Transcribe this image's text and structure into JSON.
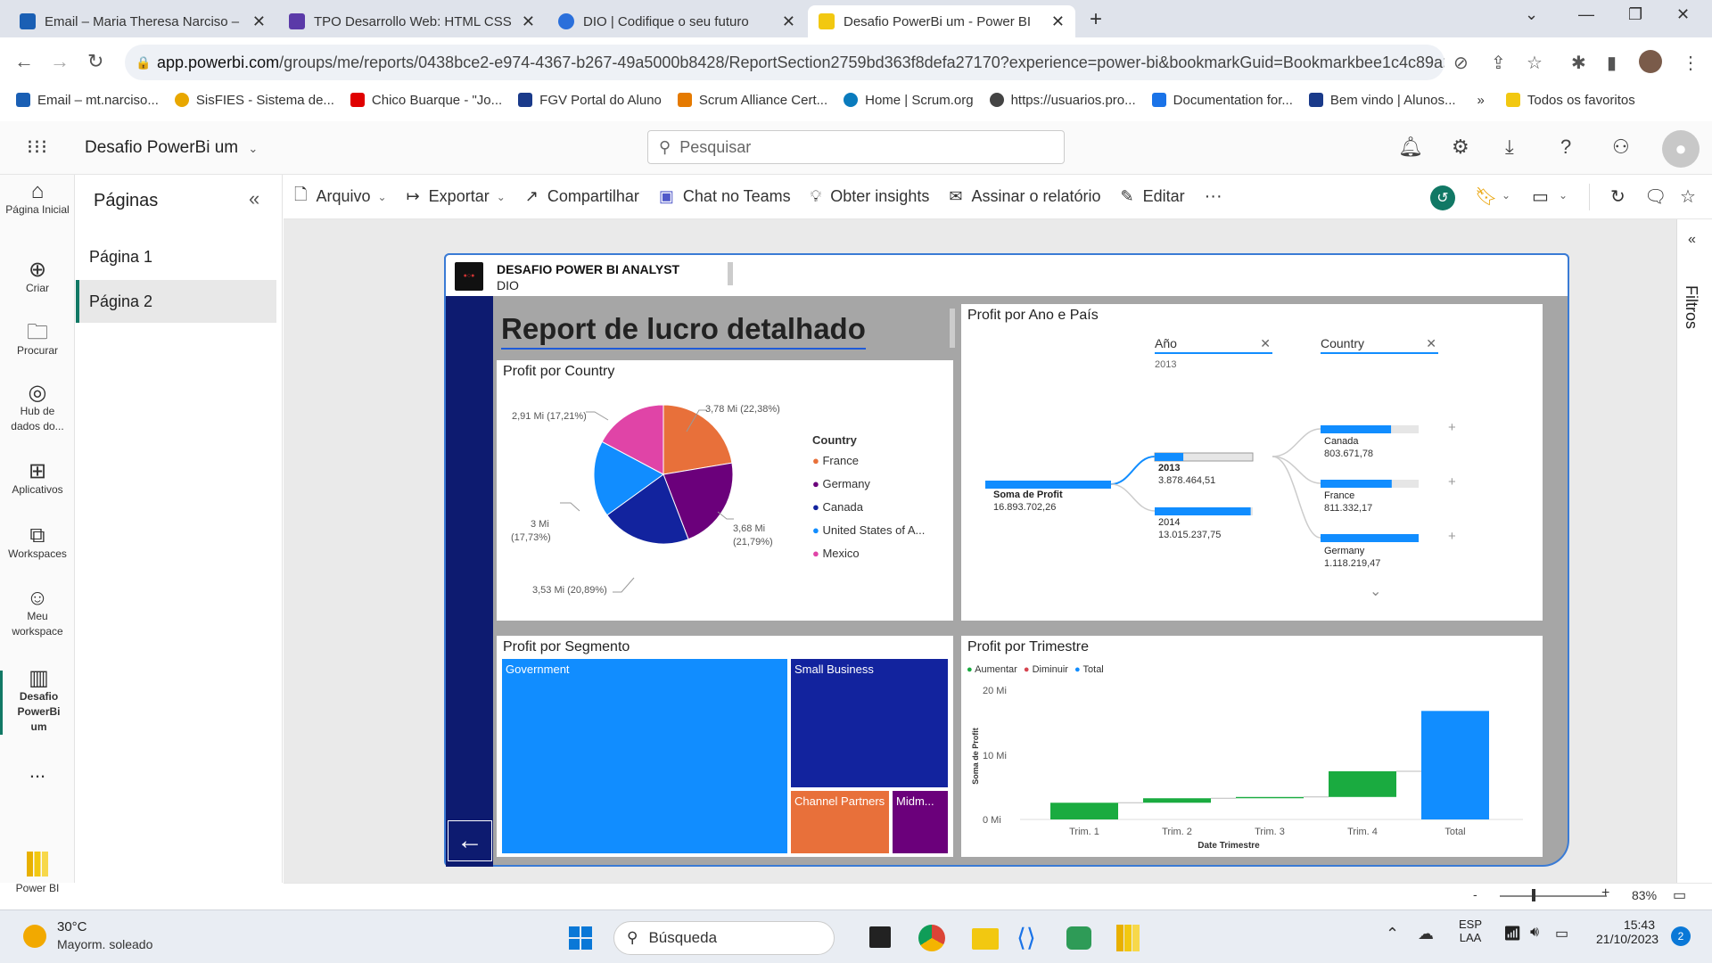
{
  "browser": {
    "tabs": [
      {
        "title": "Email – Maria Theresa Narciso –",
        "color": "#1a5fb4"
      },
      {
        "title": "TPO Desarrollo Web: HTML CSS",
        "color": "#5b3aa8"
      },
      {
        "title": "DIO | Codifique o seu futuro",
        "color": "#2a6fdb"
      },
      {
        "title": "Desafio PowerBi um - Power BI",
        "color": "#f2c811"
      }
    ],
    "new_tab": "+",
    "url_host": "app.powerbi.com",
    "url_path": "/groups/me/reports/0438bce2-e974-4367-b267-49a5000b8428/ReportSection2759bd363f8defa27170?experience=power-bi&bookmarkGuid=Bookmarkbee1c4c89a2e...",
    "bookmarks": [
      {
        "label": "Email – mt.narciso...",
        "color": "#1a5fb4"
      },
      {
        "label": "SisFIES - Sistema de...",
        "color": "#e8a700"
      },
      {
        "label": "Chico Buarque - \"Jo...",
        "color": "#e00000"
      },
      {
        "label": "FGV Portal do Aluno",
        "color": "#1a3a8a"
      },
      {
        "label": "Scrum Alliance Cert...",
        "color": "#e57a00"
      },
      {
        "label": "Home | Scrum.org",
        "color": "#0a7bbd"
      },
      {
        "label": "https://usuarios.pro...",
        "color": "#444444"
      },
      {
        "label": "Documentation for...",
        "color": "#1a73e8"
      },
      {
        "label": "Bem vindo | Alunos...",
        "color": "#1a3a8a"
      }
    ],
    "bookmarks_more": "»",
    "all_bookmarks": "Todos os favoritos"
  },
  "app": {
    "title": "Desafio PowerBi um",
    "search_placeholder": "Pesquisar"
  },
  "rail": [
    {
      "icon": "home-icon",
      "label": "Página Inicial"
    },
    {
      "icon": "create-icon",
      "label": "Criar"
    },
    {
      "icon": "browse-icon",
      "label": "Procurar"
    },
    {
      "icon": "data-hub-icon",
      "label": "Hub de dados do..."
    },
    {
      "icon": "apps-icon",
      "label": "Aplicativos"
    },
    {
      "icon": "workspaces-icon",
      "label": "Workspaces"
    },
    {
      "icon": "my-workspace-icon",
      "label": "Meu workspace"
    },
    {
      "icon": "report-icon",
      "label": "Desafio PowerBi um"
    }
  ],
  "rail_more": "...",
  "pbi_brand": "Power BI",
  "pages": {
    "heading": "Páginas",
    "items": [
      "Página 1",
      "Página 2"
    ],
    "selected": 1
  },
  "toolbar": {
    "arquivo": "Arquivo",
    "exportar": "Exportar",
    "compartilhar": "Compartilhar",
    "chat_teams": "Chat no Teams",
    "insights": "Obter insights",
    "assinar": "Assinar o relatório",
    "editar": "Editar",
    "more": "···"
  },
  "filters_label": "Filtros",
  "report": {
    "header_title": "DESAFIO POWER BI ANALYST",
    "header_sub": "DIO",
    "title": "Report de lucro detalhado",
    "pie": {
      "title": "Profit por Country",
      "legend_title": "Country",
      "labels": [
        "3,78 Mi (22,38%)",
        "3,68 Mi",
        "(21,79%)",
        "3,53 Mi (20,89%)",
        "3 Mi",
        "(17,73%)",
        "2,91 Mi (17,21%)"
      ]
    },
    "decomp": {
      "title": "Profit por Ano e País",
      "col1_header": "Año",
      "col1_value": "2013",
      "col2_header": "Country",
      "root_label": "Soma de Profit",
      "root_value": "16.893.702,26",
      "years": [
        {
          "label": "2013",
          "value": "3.878.464,51"
        },
        {
          "label": "2014",
          "value": "13.015.237,75"
        }
      ],
      "countries": [
        {
          "label": "Canada",
          "value": "803.671,78"
        },
        {
          "label": "France",
          "value": "811.332,17"
        },
        {
          "label": "Germany",
          "value": "1.118.219,47"
        }
      ]
    },
    "treemap": {
      "title": "Profit por Segmento",
      "labels": [
        "Government",
        "Small Business",
        "Channel Partners",
        "Midm..."
      ]
    },
    "waterfall": {
      "title": "Profit por Trimestre",
      "legend": [
        "Aumentar",
        "Diminuir",
        "Total"
      ],
      "ylabel": "Soma de Profit",
      "xlabel": "Date Trimestre",
      "yticks": [
        "20 Mi",
        "10 Mi",
        "0 Mi"
      ]
    }
  },
  "chart_data": [
    {
      "type": "pie",
      "title": "Profit por Country",
      "legend_title": "Country",
      "categories": [
        "France",
        "Germany",
        "Canada",
        "United States of A...",
        "Mexico"
      ],
      "values": [
        3.78,
        3.68,
        3.53,
        3.0,
        2.91
      ],
      "percent": [
        22.38,
        21.79,
        20.89,
        17.73,
        17.21
      ],
      "colors": [
        "#e8703a",
        "#6b007b",
        "#12239e",
        "#118dff",
        "#e044a7"
      ]
    },
    {
      "type": "bar",
      "title": "Profit por Ano e País",
      "root": {
        "label": "Soma de Profit",
        "value": 16893702.26
      },
      "categories": [
        "2013",
        "2014"
      ],
      "values": [
        3878464.51,
        13015237.75
      ],
      "children_2013": {
        "categories": [
          "Canada",
          "France",
          "Germany"
        ],
        "values": [
          803671.78,
          811332.17,
          1118219.47
        ]
      }
    },
    {
      "type": "heatmap",
      "title": "Profit por Segmento",
      "categories": [
        "Government",
        "Small Business",
        "Channel Partners",
        "Midm..."
      ],
      "values": [
        9.2,
        4.1,
        1.35,
        0.92
      ],
      "colors": [
        "#118dff",
        "#12239e",
        "#e8703a",
        "#6b007b"
      ]
    },
    {
      "type": "bar",
      "title": "Profit por Trimestre",
      "xlabel": "Date Trimestre",
      "ylabel": "Soma de Profit",
      "categories": [
        "Trim. 1",
        "Trim. 2",
        "Trim. 3",
        "Trim. 4",
        "Total"
      ],
      "values": [
        2.6,
        3.3,
        3.5,
        7.5,
        16.9
      ],
      "ylim": [
        0,
        20
      ],
      "colors": {
        "Aumentar": "#1aab40",
        "Diminuir": "#d64550",
        "Total": "#118dff"
      }
    }
  ],
  "status": {
    "zoom": "83%"
  },
  "taskbar": {
    "temp": "30°C",
    "weather": "Mayorm. soleado",
    "search": "Búsqueda",
    "lang1": "ESP",
    "lang2": "LAA",
    "time": "15:43",
    "date": "21/10/2023",
    "badge": "2"
  }
}
